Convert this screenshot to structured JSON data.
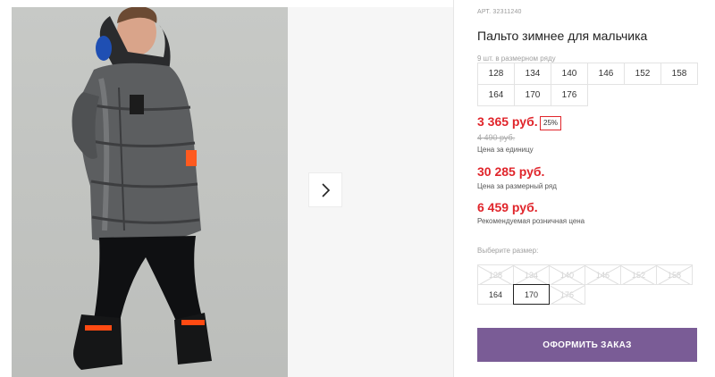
{
  "product": {
    "article": "АРТ. 32311240",
    "title": "Пальто зимнее для мальчика",
    "size_row_label": "9 шт. в размерном ряду",
    "size_row": [
      "128",
      "134",
      "140",
      "146",
      "152",
      "158",
      "164",
      "170",
      "176"
    ]
  },
  "pricing": {
    "price": "3 365 руб.",
    "discount": "25%",
    "old_price": "4 490 руб.",
    "unit_label": "Цена за единицу",
    "row_price": "30 285 руб.",
    "row_label": "Цена за размерный ряд",
    "rrp": "6 459 руб.",
    "rrp_label": "Рекомендуемая розничная цена"
  },
  "size_picker": {
    "label": "Выберите размер:",
    "sizes": [
      {
        "label": "128",
        "state": "disabled"
      },
      {
        "label": "134",
        "state": "disabled"
      },
      {
        "label": "140",
        "state": "disabled"
      },
      {
        "label": "146",
        "state": "disabled"
      },
      {
        "label": "152",
        "state": "disabled"
      },
      {
        "label": "158",
        "state": "disabled"
      },
      {
        "label": "164",
        "state": "available"
      },
      {
        "label": "170",
        "state": "selected"
      },
      {
        "label": "176",
        "state": "disabled"
      }
    ]
  },
  "order_button": "ОФОРМИТЬ ЗАКАЗ",
  "icons": {
    "next": "chevron-right-icon"
  },
  "colors": {
    "accent": "#7a5c96",
    "price": "#e0252b"
  }
}
